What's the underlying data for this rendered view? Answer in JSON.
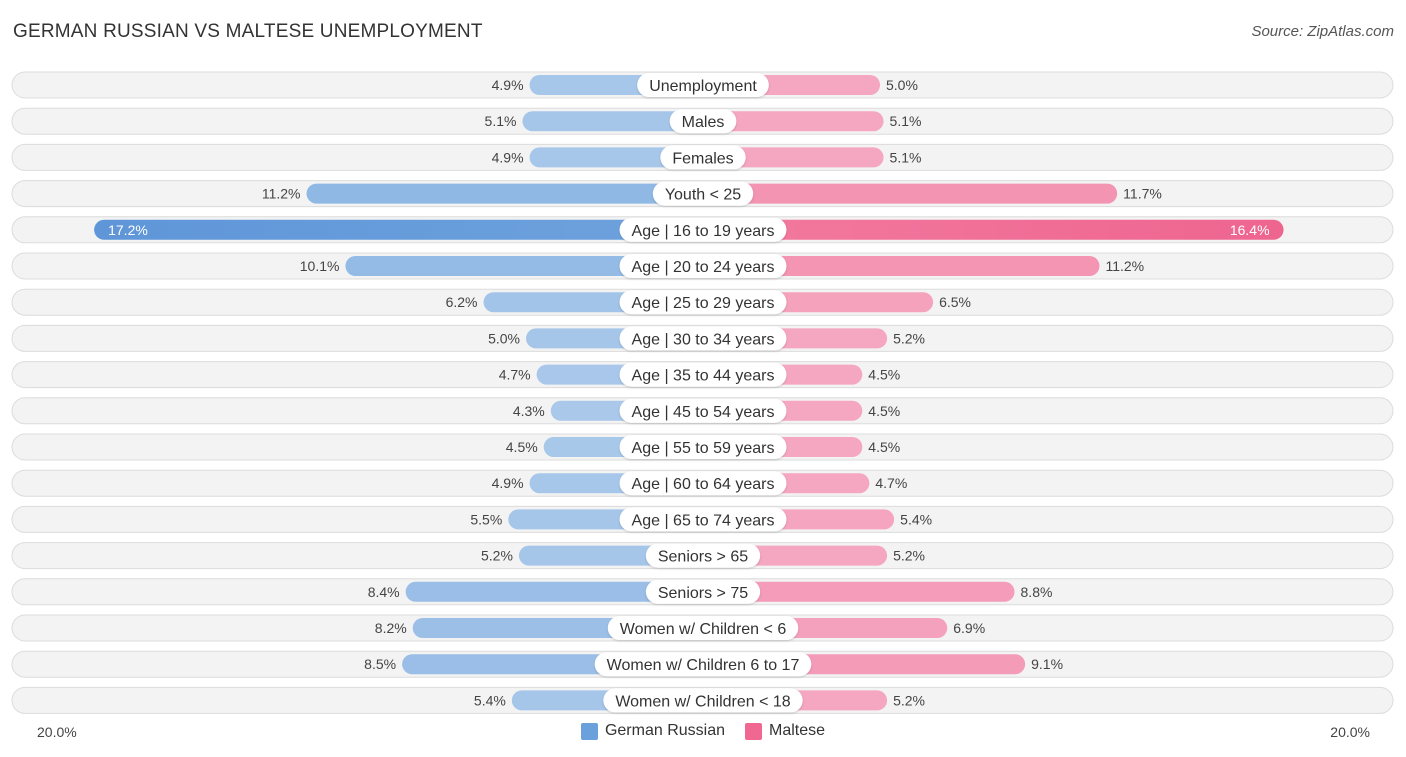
{
  "header": {
    "title": "GERMAN RUSSIAN VS MALTESE UNEMPLOYMENT",
    "source": "Source: ZipAtlas.com"
  },
  "colors": {
    "german_russian": "#6aa0dc",
    "german_russian_light": "#a9c8ea",
    "maltese": "#f06892",
    "maltese_light": "#f5a8c2"
  },
  "chart_data": {
    "type": "bar",
    "orientation": "horizontal-diverging",
    "title": "GERMAN RUSSIAN VS MALTESE UNEMPLOYMENT",
    "xlim": [
      -20.0,
      20.0
    ],
    "axis_labels": {
      "left": "20.0%",
      "right": "20.0%"
    },
    "legend": {
      "position": "bottom-center",
      "entries": [
        "German Russian",
        "Maltese"
      ]
    },
    "categories": [
      "Unemployment",
      "Males",
      "Females",
      "Youth < 25",
      "Age | 16 to 19 years",
      "Age | 20 to 24 years",
      "Age | 25 to 29 years",
      "Age | 30 to 34 years",
      "Age | 35 to 44 years",
      "Age | 45 to 54 years",
      "Age | 55 to 59 years",
      "Age | 60 to 64 years",
      "Age | 65 to 74 years",
      "Seniors > 65",
      "Seniors > 75",
      "Women w/ Children < 6",
      "Women w/ Children 6 to 17",
      "Women w/ Children < 18"
    ],
    "series": [
      {
        "name": "German Russian",
        "side": "left",
        "values": [
          4.9,
          5.1,
          4.9,
          11.2,
          17.2,
          10.1,
          6.2,
          5.0,
          4.7,
          4.3,
          4.5,
          4.9,
          5.5,
          5.2,
          8.4,
          8.2,
          8.5,
          5.4
        ],
        "labels": [
          "4.9%",
          "5.1%",
          "4.9%",
          "11.2%",
          "17.2%",
          "10.1%",
          "6.2%",
          "5.0%",
          "4.7%",
          "4.3%",
          "4.5%",
          "4.9%",
          "5.5%",
          "5.2%",
          "8.4%",
          "8.2%",
          "8.5%",
          "5.4%"
        ]
      },
      {
        "name": "Maltese",
        "side": "right",
        "values": [
          5.0,
          5.1,
          5.1,
          11.7,
          16.4,
          11.2,
          6.5,
          5.2,
          4.5,
          4.5,
          4.5,
          4.7,
          5.4,
          5.2,
          8.8,
          6.9,
          9.1,
          5.2
        ],
        "labels": [
          "5.0%",
          "5.1%",
          "5.1%",
          "11.7%",
          "16.4%",
          "11.2%",
          "6.5%",
          "5.2%",
          "4.5%",
          "4.5%",
          "4.5%",
          "4.7%",
          "5.4%",
          "5.2%",
          "8.8%",
          "6.9%",
          "9.1%",
          "5.2%"
        ]
      }
    ]
  }
}
